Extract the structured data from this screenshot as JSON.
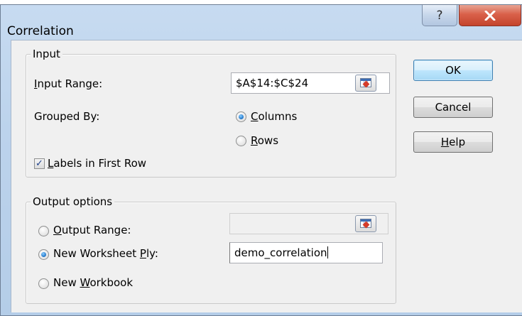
{
  "window": {
    "title": "Correlation",
    "help_glyph": "?",
    "close_glyph": "X"
  },
  "input_group": {
    "legend": "Input",
    "range_label_pre": "",
    "range_label_key": "I",
    "range_label_post": "nput Range:",
    "range_value": "$A$14:$C$24",
    "grouped_by_label": "Grouped By:",
    "columns_pre": "",
    "columns_key": "C",
    "columns_post": "olumns",
    "columns_selected": true,
    "rows_pre": "",
    "rows_key": "R",
    "rows_post": "ows",
    "rows_selected": false,
    "labels_check_mark": "✓",
    "labels_checked": true,
    "labels_pre": "",
    "labels_key": "L",
    "labels_post": "abels in First Row"
  },
  "output_group": {
    "legend": "Output options",
    "output_range_pre": "",
    "output_range_key": "O",
    "output_range_post": "utput Range:",
    "output_range_value": "",
    "output_range_selected": false,
    "new_ply_pre": "New Worksheet ",
    "new_ply_key": "P",
    "new_ply_post": "ly:",
    "new_ply_value": "demo_correlation",
    "new_ply_selected": true,
    "new_workbook_pre": "New ",
    "new_workbook_key": "W",
    "new_workbook_post": "orkbook",
    "new_workbook_selected": false
  },
  "buttons": {
    "ok": "OK",
    "cancel": "Cancel",
    "help_pre": "",
    "help_key": "H",
    "help_post": "elp"
  },
  "colors": {
    "title_bar": "#bcd3ec",
    "close_button": "#d9614a",
    "dialog_background": "#f0f0f0",
    "default_button": "#bee6fd",
    "radio_selected": "#2a7fd0"
  }
}
